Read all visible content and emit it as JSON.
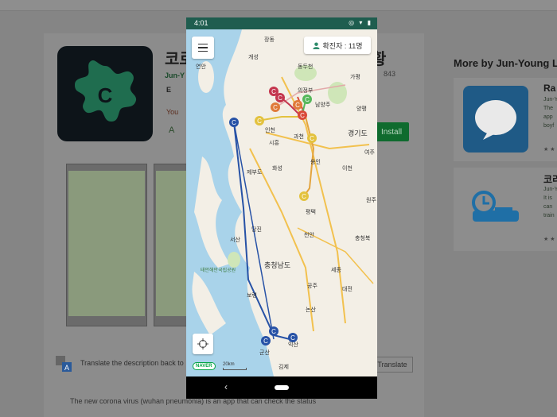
{
  "background": {
    "title_left": "코로",
    "title_right": "황",
    "developer": "Jun-Y",
    "rating_count": "843",
    "esrb": "E",
    "warning": "You",
    "wishlist": "A",
    "install_label": "Install",
    "translate_text": "Translate the description back to",
    "translate_button": "Translate",
    "description": "The new corona virus (wuhan pneumonia) is an app that can check the status"
  },
  "sidebar": {
    "more_by": "More by Jun-Young Le",
    "cards": [
      {
        "name": "Ra",
        "sub": [
          "Jun-Y",
          "The",
          "app",
          "boyf"
        ],
        "stars": "★ ★"
      },
      {
        "name": "코리",
        "sub": [
          "Jun-Y",
          "It is",
          "can",
          "train"
        ],
        "stars": "★ ★"
      }
    ]
  },
  "phone": {
    "time": "4:01",
    "confirmed_label": "확진자 : 11명",
    "naver": "NAVER",
    "scale": "20km",
    "map_labels": [
      {
        "t": "장동"
      },
      {
        "t": "개성"
      },
      {
        "t": "연안"
      },
      {
        "t": "동두천"
      },
      {
        "t": "가평"
      },
      {
        "t": "의정부"
      },
      {
        "t": "남양주"
      },
      {
        "t": "인천"
      },
      {
        "t": "시흥"
      },
      {
        "t": "과천"
      },
      {
        "t": "경기도",
        "big": true
      },
      {
        "t": "여주"
      },
      {
        "t": "화성"
      },
      {
        "t": "용인"
      },
      {
        "t": "이천"
      },
      {
        "t": "평택"
      },
      {
        "t": "당진"
      },
      {
        "t": "천안"
      },
      {
        "t": "충청북"
      },
      {
        "t": "서산"
      },
      {
        "t": "충청남도",
        "big": true
      },
      {
        "t": "세종"
      },
      {
        "t": "공주"
      },
      {
        "t": "대전"
      },
      {
        "t": "보령"
      },
      {
        "t": "논산"
      },
      {
        "t": "김제"
      },
      {
        "t": "익산"
      },
      {
        "t": "제부도"
      },
      {
        "t": "태안해안국립공원"
      },
      {
        "t": "양평"
      },
      {
        "t": "원주"
      },
      {
        "t": "군산"
      }
    ]
  },
  "colors": {
    "app_icon_bg": "#0d1419",
    "app_icon_fg": "#1f6d4f",
    "status_bar": "#1f5d4f",
    "install": "#0f6b2e"
  }
}
